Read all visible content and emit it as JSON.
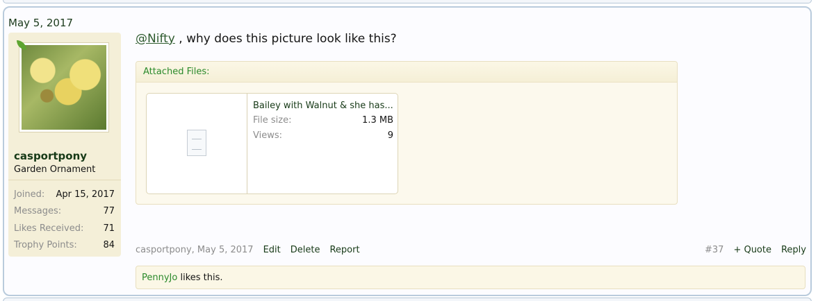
{
  "post": {
    "date": "May 5, 2017",
    "user": {
      "name": "casportpony",
      "title": "Garden Ornament",
      "stats": [
        {
          "label": "Joined:",
          "value": "Apr 15, 2017"
        },
        {
          "label": "Messages:",
          "value": "77"
        },
        {
          "label": "Likes Received:",
          "value": "71"
        },
        {
          "label": "Trophy Points:",
          "value": "84"
        }
      ]
    },
    "message": {
      "mention": "@Nifty",
      "text": " , why does this picture look like this?"
    },
    "attachments": {
      "header": "Attached Files:",
      "file": {
        "name": "Bailey with Walnut & she has...",
        "size_label": "File size:",
        "size_value": "1.3 MB",
        "views_label": "Views:",
        "views_value": "9"
      }
    },
    "meta": {
      "author_date": "casportpony, May 5, 2017",
      "edit": "Edit",
      "delete": "Delete",
      "report": "Report",
      "number": "#37",
      "quote": "+ Quote",
      "reply": "Reply"
    },
    "likes": {
      "liker": "PennyJo",
      "text": " likes this."
    }
  }
}
